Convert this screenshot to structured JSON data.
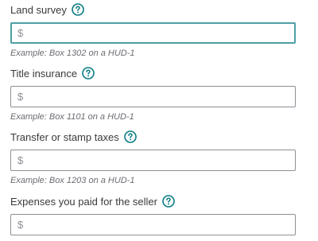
{
  "fields": [
    {
      "label": "Land survey",
      "currency_prefix": "$",
      "value": "",
      "example": "Example: Box 1302 on a HUD-1",
      "focused": true
    },
    {
      "label": "Title insurance",
      "currency_prefix": "$",
      "value": "",
      "example": "Example: Box 1101 on a HUD-1",
      "focused": false
    },
    {
      "label": "Transfer or stamp taxes",
      "currency_prefix": "$",
      "value": "",
      "example": "Example: Box 1203 on a HUD-1",
      "focused": false
    },
    {
      "label": "Expenses you paid for the seller",
      "currency_prefix": "$",
      "value": "",
      "example": "",
      "focused": false
    }
  ],
  "icons": {
    "help": "question-circle-icon"
  },
  "colors": {
    "accent": "#0a7b83",
    "focus_border": "#4e9fa6",
    "input_border": "#8d9096",
    "label_text": "#393a3d",
    "hint_text": "#6b6c72"
  }
}
